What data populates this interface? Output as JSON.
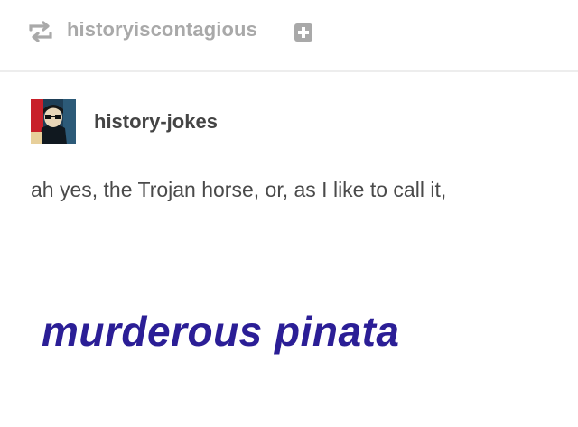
{
  "reblog": {
    "icon": "reblog-icon",
    "username": "historyiscontagious",
    "follow_icon": "plus-icon"
  },
  "post": {
    "author": "history-jokes",
    "avatar_icon": "avatar-image",
    "text": "ah yes, the Trojan horse, or, as I like to call it,",
    "punchline": "murderous pinata"
  },
  "colors": {
    "muted_gray": "#a9a9a9",
    "text_dark": "#444444",
    "punchline_blue": "#2b1e96",
    "divider": "#ededed"
  }
}
